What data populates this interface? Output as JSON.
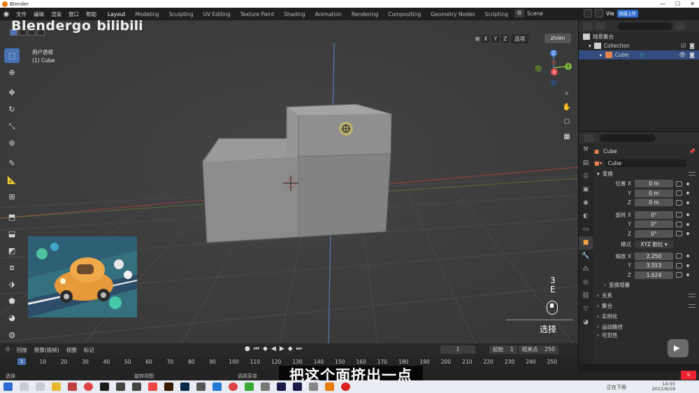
{
  "window": {
    "title": "Blender",
    "controls": [
      "—",
      "☐",
      "✕"
    ]
  },
  "menubar": {
    "menus": [
      "文件",
      "编辑",
      "渲染",
      "窗口",
      "帮助"
    ],
    "workspaces": [
      "Layout",
      "Modeling",
      "Sculpting",
      "UV Editing",
      "Texture Paint",
      "Shading",
      "Animation",
      "Rendering",
      "Compositing",
      "Geometry Nodes",
      "Scripting"
    ],
    "active_workspace": "Layout",
    "scene": "Scene",
    "view_layer": "Vie",
    "blue_button": "拍摄上传"
  },
  "watermark": {
    "brand": "Blendergo",
    "site": "bilibili"
  },
  "viewport": {
    "view_name": "用户透视",
    "object_info": "(1) Cube",
    "axes": [
      "X",
      "Y",
      "Z"
    ],
    "options_label": "选项",
    "lang_button": "zh/en",
    "gizmo_axes": {
      "x": "X",
      "y": "Y",
      "z": "Z"
    },
    "colors": {
      "x": "#e8484a",
      "y": "#7db93d",
      "z": "#4a84d8",
      "bg": "#3c3c3c"
    }
  },
  "screencast": {
    "count": "3",
    "key": "E",
    "action": "选择"
  },
  "outliner": {
    "root": "场景集合",
    "collection": "Collection",
    "object": "Cube"
  },
  "properties": {
    "object_name": "Cube",
    "data_name": "Cube",
    "transform_label": "变换",
    "location": {
      "label": "位置",
      "x": "0 m",
      "y": "0 m",
      "z": "0 m"
    },
    "rotation": {
      "label": "旋转",
      "x": "0°",
      "y": "0°",
      "z": "0°"
    },
    "mode": {
      "label": "模式",
      "value": "XYZ 欧拉"
    },
    "scale": {
      "label": "缩放",
      "x": "2.250",
      "y": "3.553",
      "z": "1.624"
    },
    "axis_labels": {
      "x": "X",
      "y": "Y",
      "z": "Z"
    },
    "sections": [
      "变换增量",
      "关系",
      "集合",
      "实例化",
      "运动路径",
      "可见性"
    ]
  },
  "timeline": {
    "menus": [
      "回放",
      "抠像(插帧)",
      "视图",
      "标记"
    ],
    "current_frame": "1",
    "start_label": "起始",
    "start": "1",
    "end_label": "结束点",
    "end": "250",
    "ticks": [
      "1",
      "10",
      "20",
      "30",
      "40",
      "50",
      "60",
      "70",
      "80",
      "90",
      "100",
      "110",
      "120",
      "130",
      "140",
      "150",
      "160",
      "170",
      "180",
      "190",
      "200",
      "210",
      "220",
      "230",
      "240",
      "250"
    ]
  },
  "statusbar": {
    "select": "选择",
    "rotate": "旋转视图",
    "menu": "调用菜单"
  },
  "subtitle": "把这个面挤出一点",
  "taskbar": {
    "date": "2022/6/19",
    "time": "14:55",
    "notify": "正在下雨"
  }
}
